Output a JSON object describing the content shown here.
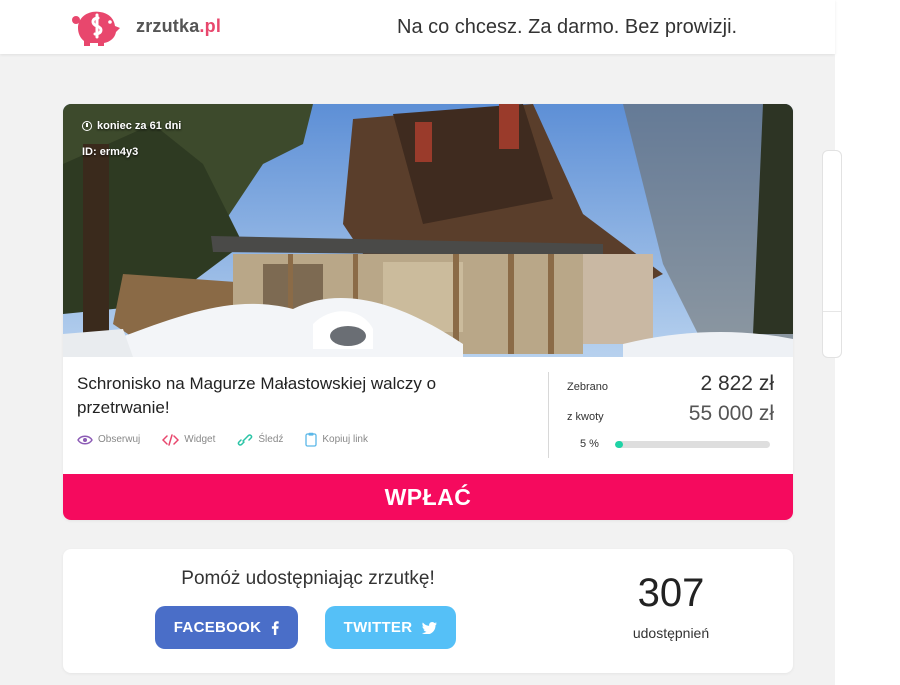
{
  "header": {
    "logo_name": "zrzutka",
    "logo_tld": ".pl",
    "tagline": "Na co chcesz. Za darmo. Bez prowizji."
  },
  "campaign": {
    "ends_in": "koniec za 61 dni",
    "id_label": "ID: erm4y3",
    "title": "Schronisko na Magurze Małastowskiej walczy o przetrwanie!",
    "actions": {
      "watch": "Obserwuj",
      "widget": "Widget",
      "track": "Śledź",
      "copy_link": "Kopiuj link"
    },
    "raised_label": "Zebrano",
    "raised_value": "2 822 zł",
    "goal_label": "z kwoty",
    "goal_value": "55 000 zł",
    "progress_label": "5 %",
    "progress_fraction": 0.05,
    "donate_label": "WPŁAĆ"
  },
  "share": {
    "title": "Pomóż udostępniając zrzutkę!",
    "facebook_label": "FACEBOOK",
    "twitter_label": "TWITTER",
    "count": "307",
    "count_label": "udostępnień"
  },
  "colors": {
    "brand_pink": "#f50a5e",
    "logo_pink": "#e8476d",
    "progress": "#1fd3a6",
    "facebook": "#4a6ec8",
    "twitter": "#55c0f7"
  },
  "icons": [
    "clock-icon",
    "eye-icon",
    "code-icon",
    "link-icon",
    "clipboard-icon",
    "facebook-icon",
    "twitter-icon",
    "piggy-logo-icon"
  ]
}
